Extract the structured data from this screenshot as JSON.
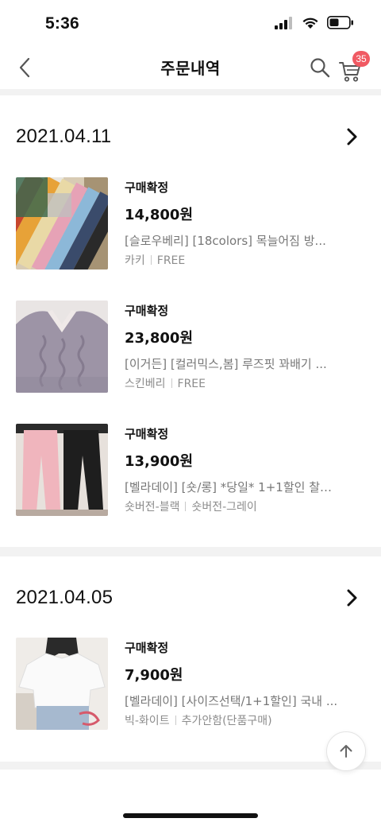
{
  "status_bar": {
    "time": "5:36"
  },
  "header": {
    "title": "주문내역",
    "cart_count": "35"
  },
  "orders": [
    {
      "date": "2021.04.11",
      "items": [
        {
          "status": "구매확정",
          "price": "14,800원",
          "title": "[슬로우베리] [18colors] 목늘어짐 방...",
          "options": [
            "카키",
            "FREE"
          ]
        },
        {
          "status": "구매확정",
          "price": "23,800원",
          "title": "[이거든] [컬러믹스,봄] 루즈핏 꽈배기 ...",
          "options": [
            "스킨베리",
            "FREE"
          ]
        },
        {
          "status": "구매확정",
          "price": "13,900원",
          "title": "[벨라데이] [숏/롱] *당일* 1+1할인 찰랑...",
          "options": [
            "숏버전-블랙",
            "숏버전-그레이"
          ]
        }
      ]
    },
    {
      "date": "2021.04.05",
      "items": [
        {
          "status": "구매확정",
          "price": "7,900원",
          "title": "[벨라데이] [사이즈선택/1+1할인] 국내 ...",
          "options": [
            "빅-화이트",
            "추가안함(단품구매)"
          ]
        }
      ]
    }
  ],
  "colors": {
    "badge": "#f05a63",
    "separator": "#f2f2f2",
    "muted_text": "#777777"
  }
}
